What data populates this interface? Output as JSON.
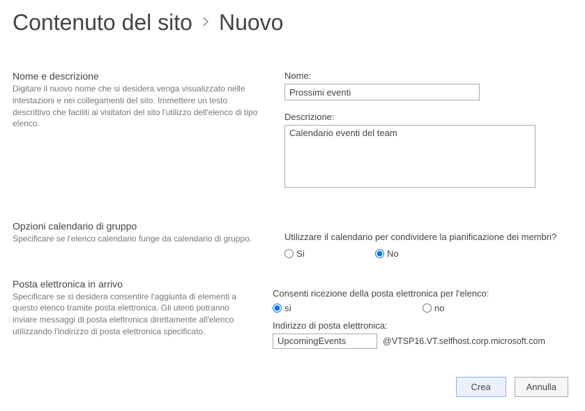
{
  "breadcrumb": {
    "parent": "Contenuto del sito",
    "current": "Nuovo"
  },
  "sections": {
    "name_desc": {
      "title": "Nome e descrizione",
      "desc": "Digitare il nuovo nome che si desidera venga visualizzato nelle intestazioni e nei collegamenti del sito. Immettere un testo descrittivo che faciliti ai visitatori del sito l'utilizzo dell'elenco di tipo elenco."
    },
    "group_cal": {
      "title": "Opzioni calendario di gruppo",
      "desc": "Specificare se l'elenco calendario funge da calendario di gruppo."
    },
    "incoming_email": {
      "title": "Posta elettronica in arrivo",
      "desc": "Specificare se si desidera consentire l'aggiunta di elementi a questo elenco tramite posta elettronica. Gli utenti potranno inviare messaggi di posta elettronica direttamente all'elenco utilizzando l'indirizzo di posta elettronica specificato."
    }
  },
  "fields": {
    "name_label": "Nome:",
    "name_value": "Prossimi eventi",
    "desc_label": "Descrizione:",
    "desc_value": "Calendario eventi del team",
    "group_cal_question": "Utilizzare il calendario per condividere la pianificazione dei membri?",
    "yes_si_cap": "Sì",
    "no_cap": "No",
    "email_allow_question": "Consenti ricezione della posta elettronica per l'elenco:",
    "yes_si": "sì",
    "no": "no",
    "email_addr_label": "Indirizzo di posta elettronica:",
    "email_value": "UpcomingEvents",
    "email_suffix": "@VTSP16.VT.selfhost.corp.microsoft.com"
  },
  "buttons": {
    "create": "Crea",
    "cancel": "Annulla"
  }
}
